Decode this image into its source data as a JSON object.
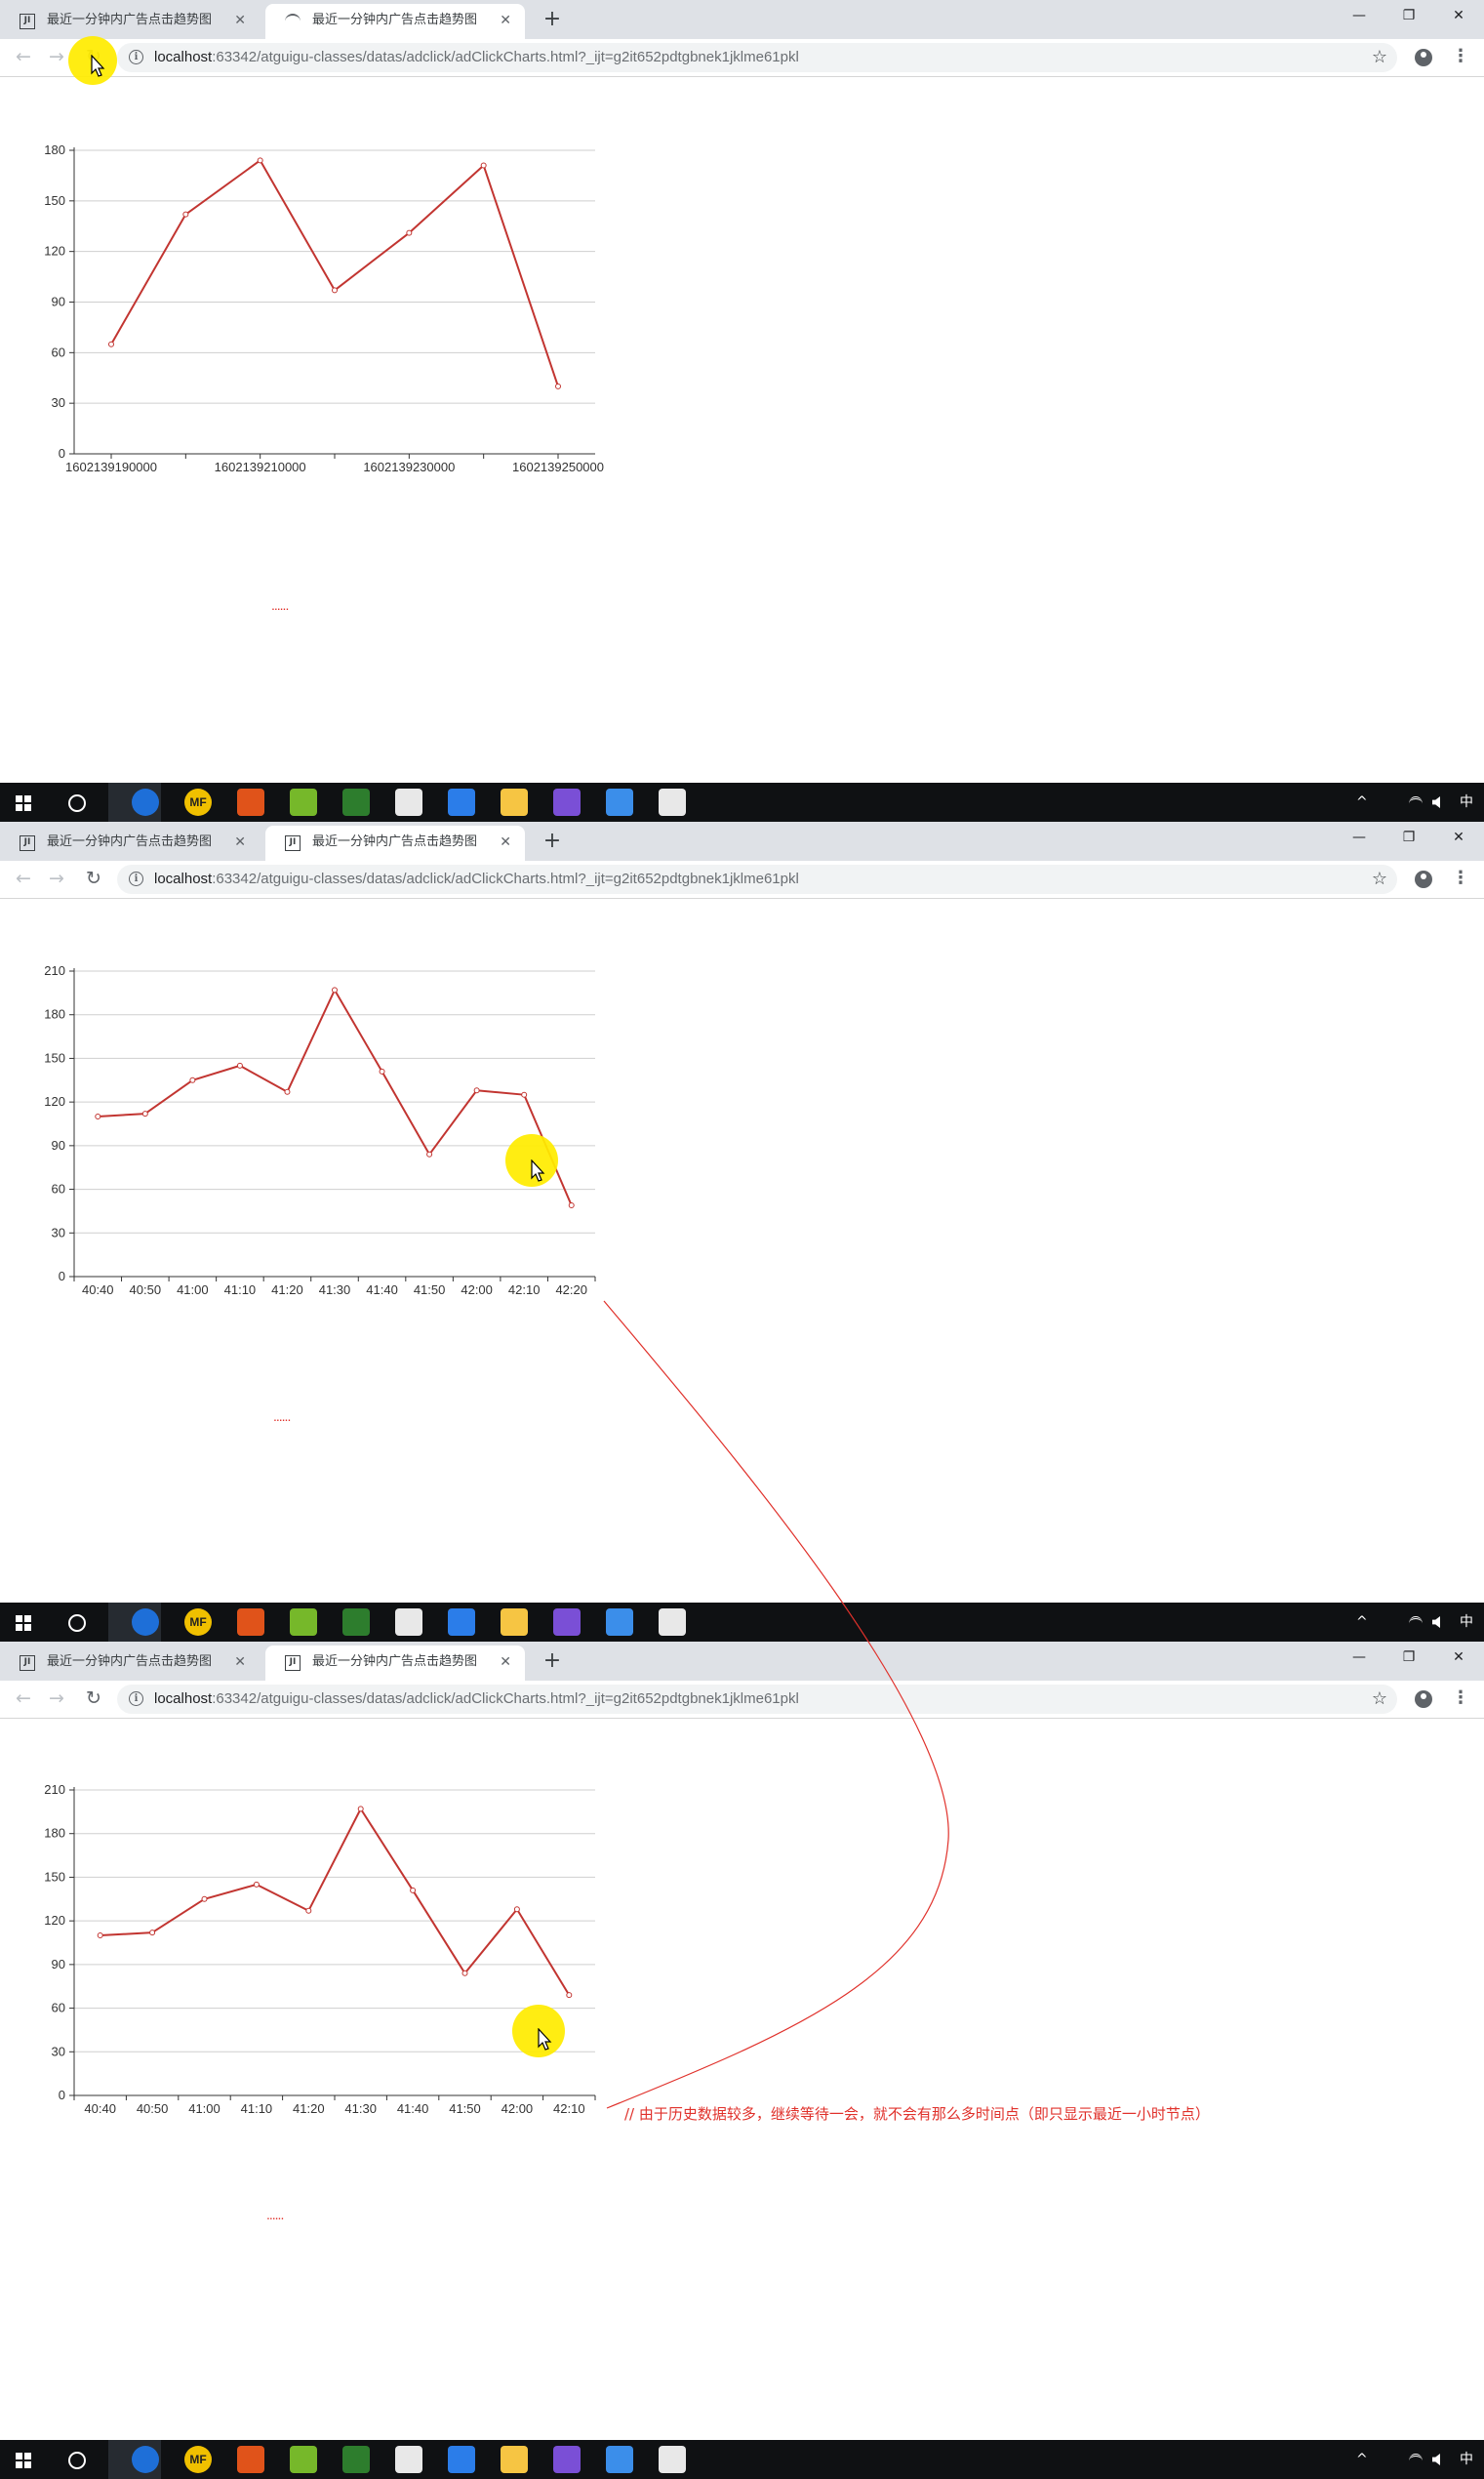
{
  "browser": {
    "tabs": [
      {
        "title": "最近一分钟内广告点击趋势图",
        "close": "✕"
      },
      {
        "title": "最近一分钟内广告点击趋势图",
        "close": "✕"
      }
    ],
    "new_tab": "+",
    "window_buttons": {
      "minimize": "—",
      "restore": "❐",
      "close": "✕"
    },
    "nav": {
      "back": "←",
      "forward": "→",
      "reload": "↻"
    },
    "info_icon": "i",
    "url_host": "localhost",
    "url_rest": ":63342/atguigu-classes/datas/adclick/adClickCharts.html?_ijt=g2it652pdtgbnek1jklme61pkl",
    "star": "☆",
    "menu": "⋮"
  },
  "taskbar": {
    "tray_caret": "^",
    "ime": "中",
    "app_labels": [
      "MF"
    ],
    "colors": [
      "#1e6fd8",
      "#f0c000",
      "#e0531a",
      "#76b82a",
      "#2d7d2d",
      "#e8e8e8",
      "#2b7de9",
      "#f6c543",
      "#7a4fd6",
      "#3b8eea",
      "#e8e8e8"
    ]
  },
  "page_dots": "......",
  "annotation": "// 由于历史数据较多，继续等待一会，就不会有那么多时间点（即只显示最近一小时节点）",
  "colors": {
    "line": "#c23531",
    "annotation": "#e0312b",
    "highlight": "#ffec00"
  },
  "chart_data": [
    {
      "type": "line",
      "x": [
        "1602139190000",
        "1602139200000",
        "1602139210000",
        "1602139220000",
        "1602139230000",
        "1602139240000",
        "1602139250000"
      ],
      "xtick_labels": [
        "1602139190000",
        "1602139210000",
        "1602139230000",
        "1602139250000"
      ],
      "values": [
        65,
        142,
        174,
        97,
        131,
        171,
        40
      ],
      "yticks": [
        0,
        30,
        60,
        90,
        120,
        150,
        180
      ],
      "ylim": [
        0,
        180
      ],
      "grid": true
    },
    {
      "type": "line",
      "x": [
        "40:40",
        "40:50",
        "41:00",
        "41:10",
        "41:20",
        "41:30",
        "41:40",
        "41:50",
        "42:00",
        "42:10",
        "42:20"
      ],
      "xtick_labels": [
        "40:40",
        "40:50",
        "41:00",
        "41:10",
        "41:20",
        "41:30",
        "41:40",
        "41:50",
        "42:00",
        "42:10",
        "42:20"
      ],
      "values": [
        110,
        112,
        135,
        145,
        127,
        197,
        141,
        84,
        128,
        125,
        49
      ],
      "yticks": [
        0,
        30,
        60,
        90,
        120,
        150,
        180,
        210
      ],
      "ylim": [
        0,
        210
      ],
      "grid": true
    },
    {
      "type": "line",
      "x": [
        "40:40",
        "40:50",
        "41:00",
        "41:10",
        "41:20",
        "41:30",
        "41:40",
        "41:50",
        "42:00",
        "42:10"
      ],
      "xtick_labels": [
        "40:40",
        "40:50",
        "41:00",
        "41:10",
        "41:20",
        "41:30",
        "41:40",
        "41:50",
        "42:00",
        "42:10"
      ],
      "values": [
        110,
        112,
        135,
        145,
        127,
        197,
        141,
        84,
        128,
        69
      ],
      "yticks": [
        0,
        30,
        60,
        90,
        120,
        150,
        180,
        210
      ],
      "ylim": [
        0,
        210
      ],
      "grid": true
    }
  ]
}
